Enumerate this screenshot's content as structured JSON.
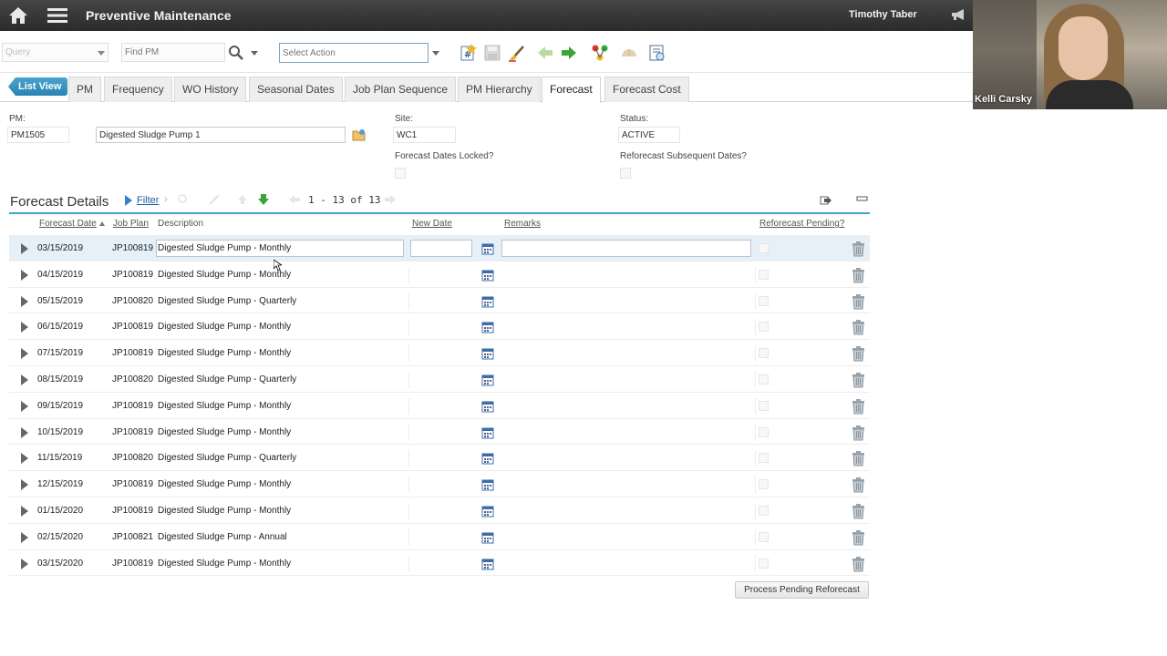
{
  "app": {
    "title": "Preventive Maintenance",
    "user": "Timothy Taber"
  },
  "video": {
    "participant": "Kelli Carsky"
  },
  "toolbar": {
    "query_placeholder": "Query",
    "find_placeholder": "Find PM",
    "action_placeholder": "Select Action"
  },
  "tabs": {
    "list_view": "List View",
    "items": [
      {
        "label": "PM"
      },
      {
        "label": "Frequency"
      },
      {
        "label": "WO History"
      },
      {
        "label": "Seasonal Dates"
      },
      {
        "label": "Job Plan Sequence"
      },
      {
        "label": "PM Hierarchy"
      },
      {
        "label": "Forecast"
      },
      {
        "label": "Forecast Cost"
      }
    ],
    "active": "Forecast"
  },
  "header": {
    "pm_label": "PM:",
    "pm_value": "PM1505",
    "pm_description": "Digested Sludge Pump 1",
    "site_label": "Site:",
    "site_value": "WC1",
    "status_label": "Status:",
    "status_value": "ACTIVE",
    "locked_label": "Forecast Dates Locked?",
    "reforecast_label": "Reforecast Subsequent Dates?"
  },
  "details": {
    "title": "Forecast Details",
    "filter_label": "Filter",
    "pager": "1 - 13 of 13",
    "columns": {
      "forecast_date": "Forecast Date",
      "job_plan": "Job Plan",
      "description": "Description",
      "new_date": "New Date",
      "remarks": "Remarks",
      "reforecast_pending": "Reforecast Pending?"
    },
    "rows": [
      {
        "date": "03/15/2019",
        "plan": "JP100819",
        "desc": "Digested Sludge Pump - Monthly"
      },
      {
        "date": "04/15/2019",
        "plan": "JP100819",
        "desc": "Digested Sludge Pump - Monthly"
      },
      {
        "date": "05/15/2019",
        "plan": "JP100820",
        "desc": "Digested Sludge Pump - Quarterly"
      },
      {
        "date": "06/15/2019",
        "plan": "JP100819",
        "desc": "Digested Sludge Pump - Monthly"
      },
      {
        "date": "07/15/2019",
        "plan": "JP100819",
        "desc": "Digested Sludge Pump - Monthly"
      },
      {
        "date": "08/15/2019",
        "plan": "JP100820",
        "desc": "Digested Sludge Pump - Quarterly"
      },
      {
        "date": "09/15/2019",
        "plan": "JP100819",
        "desc": "Digested Sludge Pump - Monthly"
      },
      {
        "date": "10/15/2019",
        "plan": "JP100819",
        "desc": "Digested Sludge Pump - Monthly"
      },
      {
        "date": "11/15/2019",
        "plan": "JP100820",
        "desc": "Digested Sludge Pump - Quarterly"
      },
      {
        "date": "12/15/2019",
        "plan": "JP100819",
        "desc": "Digested Sludge Pump - Monthly"
      },
      {
        "date": "01/15/2020",
        "plan": "JP100819",
        "desc": "Digested Sludge Pump - Monthly"
      },
      {
        "date": "02/15/2020",
        "plan": "JP100821",
        "desc": "Digested Sludge Pump - Annual"
      },
      {
        "date": "03/15/2020",
        "plan": "JP100819",
        "desc": "Digested Sludge Pump - Monthly"
      }
    ],
    "process_button": "Process Pending Reforecast"
  },
  "colors": {
    "titlebar": "#333333",
    "accent": "#3ea4c9",
    "link": "#1a5fa8",
    "selected_row": "#e5f0f8"
  }
}
